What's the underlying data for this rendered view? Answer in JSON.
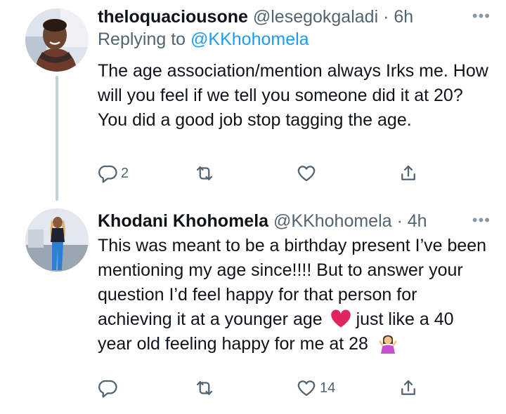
{
  "tweets": [
    {
      "display_name": "theloquaciousone",
      "handle": "@lesegokgaladi",
      "separator": "·",
      "time": "6h",
      "replying_prefix": "Replying to",
      "replying_to": "@KKhohomela",
      "text": "The age association/mention  always Irks me. How will you feel if we tell you someone did it at 20? You did a good job stop tagging the age.",
      "reply_count": "2",
      "retweet_count": "",
      "like_count": "",
      "more_icon": "ellipsis-icon"
    },
    {
      "display_name": "Khodani Khohomela",
      "handle": "@KKhohomela",
      "separator": "·",
      "time": "4h",
      "text_part1": "This was meant to be a birthday present I’ve been mentioning my age since!!!! But to answer your question I’d feel happy for that person for achieving it at a younger age",
      "text_part2": "just like a 40 year old feeling happy for me at 28",
      "emoji_1": "red-heart-emoji",
      "emoji_2": "person-shrugging-emoji",
      "reply_count": "",
      "retweet_count": "",
      "like_count": "14",
      "more_icon": "ellipsis-icon"
    }
  ],
  "colors": {
    "link": "#1d9bf0",
    "secondary_text": "#536471",
    "thread_line": "#c4cfd6",
    "heart": "#e0245e"
  }
}
